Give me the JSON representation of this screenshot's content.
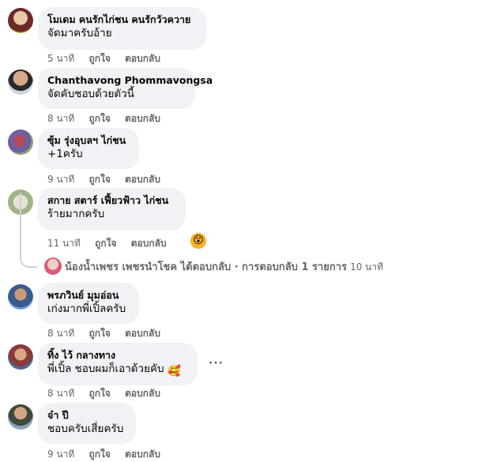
{
  "comments": [
    {
      "name": "โมเดม คนรักไก่ชน คนรักวัวควาย",
      "text": "จัดมาครับอ้าย",
      "time": "5 นาที",
      "like": "ถูกใจ",
      "reply": "ตอบกลับ"
    },
    {
      "name": "Chanthavong Phommavongsa",
      "text": "จัดคับชอบด้วยตัวนี้",
      "time": "8 นาที",
      "like": "ถูกใจ",
      "reply": "ตอบกลับ"
    },
    {
      "name": "ซุ้ม รุ่งอุบลฯ ไก่ชน",
      "text": "+1ครับ",
      "time": "9 นาที",
      "like": "ถูกใจ",
      "reply": "ตอบกลับ"
    },
    {
      "name": "สกาย สตาร์ เฟี้ยวฟ้าว ไก่ชน",
      "text": "ร้ายมากครับ",
      "time": "11 นาที",
      "like": "ถูกใจ",
      "reply": "ตอบกลับ",
      "reaction": "😮"
    },
    {
      "name": "พรภวินย์ มุมอ่อน",
      "text": "เก่งมากพี่เปิ้ลครับ",
      "time": "8 นาที",
      "like": "ถูกใจ",
      "reply": "ตอบกลับ"
    },
    {
      "name": "ทิ้ง ไว้ กลางทาง",
      "text": "พี่เปิ้ล ชอบผมก็เอาด้วยคับ",
      "text_emoji": "🥰",
      "time": "8 นาที",
      "like": "ถูกใจ",
      "reply": "ตอบกลับ",
      "more": "···"
    },
    {
      "name": "จ๋า ปี",
      "text": "ชอบครับเสี่ยครับ",
      "time": "9 นาที",
      "like": "ถูกใจ",
      "reply": "ตอบกลับ"
    }
  ],
  "reply_summary": {
    "text": "น้องน้ำเพชร เพชรนำโชค ได้ตอบกลับ · การตอบกลับ 1 รายการ",
    "time": "10 นาที"
  },
  "colors": {
    "bubble": "#f0f2f5",
    "meta": "#65676b",
    "text": "#050505"
  }
}
